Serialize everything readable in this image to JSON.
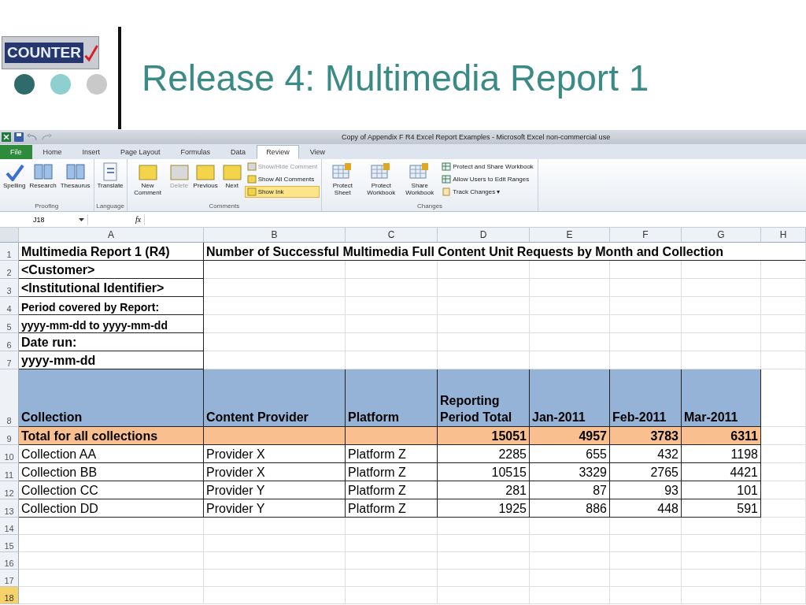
{
  "slide": {
    "logo_text": "COUNTER",
    "dots": [
      {
        "color": "#2f6b6a"
      },
      {
        "color": "#8ecfd0"
      },
      {
        "color": "#c9c9c9"
      }
    ],
    "title": "Release 4: Multimedia Report 1"
  },
  "excel": {
    "title": "Copy of Appendix F R4  Excel Report Examples  -  Microsoft Excel non-commercial use",
    "tabs": [
      {
        "label": "File",
        "kind": "file",
        "selected": false
      },
      {
        "label": "Home",
        "kind": "tab",
        "selected": false
      },
      {
        "label": "Insert",
        "kind": "tab",
        "selected": false
      },
      {
        "label": "Page Layout",
        "kind": "tab",
        "selected": false
      },
      {
        "label": "Formulas",
        "kind": "tab",
        "selected": false
      },
      {
        "label": "Data",
        "kind": "tab",
        "selected": false
      },
      {
        "label": "Review",
        "kind": "tab",
        "selected": true
      },
      {
        "label": "View",
        "kind": "tab",
        "selected": false
      }
    ],
    "groups": [
      {
        "label": "Proofing",
        "buttons": [
          {
            "label": "Spelling",
            "kind": "large",
            "disabled": false,
            "selected": false
          },
          {
            "label": "Research",
            "kind": "large",
            "disabled": false,
            "selected": false
          },
          {
            "label": "Thesaurus",
            "kind": "large",
            "disabled": false,
            "selected": false
          }
        ]
      },
      {
        "label": "Language",
        "buttons": [
          {
            "label": "Translate",
            "kind": "large",
            "disabled": false,
            "selected": false
          }
        ]
      },
      {
        "label": "Comments",
        "buttons": [
          {
            "label": "New Comment",
            "kind": "large",
            "disabled": false,
            "selected": false
          },
          {
            "label": "Delete",
            "kind": "large",
            "disabled": true,
            "selected": false
          },
          {
            "label": "Previous",
            "kind": "large",
            "disabled": false,
            "selected": false
          },
          {
            "label": "Next",
            "kind": "large",
            "disabled": false,
            "selected": false
          },
          {
            "label": "Show/Hide Comment",
            "kind": "small",
            "disabled": true,
            "selected": false
          },
          {
            "label": "Show All Comments",
            "kind": "small",
            "disabled": false,
            "selected": false
          },
          {
            "label": "Show Ink",
            "kind": "small",
            "disabled": false,
            "selected": true
          }
        ]
      },
      {
        "label": "Changes",
        "buttons": [
          {
            "label": "Protect Sheet",
            "kind": "large",
            "disabled": false,
            "selected": false
          },
          {
            "label": "Protect Workbook",
            "kind": "large",
            "disabled": false,
            "selected": false
          },
          {
            "label": "Share Workbook",
            "kind": "large",
            "disabled": false,
            "selected": false
          },
          {
            "label": "Protect and Share Workbook",
            "kind": "small",
            "disabled": false,
            "selected": false
          },
          {
            "label": "Allow Users to Edit Ranges",
            "kind": "small",
            "disabled": false,
            "selected": false
          },
          {
            "label": "Track Changes ▾",
            "kind": "small",
            "disabled": false,
            "selected": false
          }
        ]
      }
    ],
    "name_box": "J18",
    "function_label": "fx",
    "columns": [
      "A",
      "B",
      "C",
      "D",
      "E",
      "F",
      "G",
      "H"
    ],
    "rows": [
      {
        "number": "1",
        "kind": "title",
        "selected": false,
        "cells": [
          "Multimedia Report 1 (R4)",
          "Number of Successful Multimedia Full Content Unit Requests by Month and Collection"
        ]
      },
      {
        "number": "2",
        "kind": "info",
        "selected": false,
        "cells": [
          "<Customer>"
        ]
      },
      {
        "number": "3",
        "kind": "info",
        "selected": false,
        "cells": [
          "<Institutional Identifier>"
        ]
      },
      {
        "number": "4",
        "kind": "info-small",
        "selected": false,
        "cells": [
          "Period covered by Report:"
        ]
      },
      {
        "number": "5",
        "kind": "info-small",
        "selected": false,
        "cells": [
          "yyyy-mm-dd to yyyy-mm-dd"
        ]
      },
      {
        "number": "6",
        "kind": "info",
        "selected": false,
        "cells": [
          "Date run:"
        ]
      },
      {
        "number": "7",
        "kind": "info",
        "selected": false,
        "cells": [
          "yyyy-mm-dd"
        ]
      },
      {
        "number": "8",
        "kind": "header",
        "selected": false,
        "cells": [
          "Collection",
          "Content Provider",
          "Platform",
          "Reporting Period Total",
          "Jan-2011",
          "Feb-2011",
          "Mar-2011"
        ]
      },
      {
        "number": "9",
        "kind": "total",
        "selected": false,
        "cells": [
          "Total for all collections",
          "",
          "",
          "15051",
          "4957",
          "3783",
          "6311"
        ]
      },
      {
        "number": "10",
        "kind": "data",
        "selected": false,
        "cells": [
          "Collection AA",
          "Provider X",
          "Platform Z",
          "2285",
          "655",
          "432",
          "1198"
        ]
      },
      {
        "number": "11",
        "kind": "data",
        "selected": false,
        "cells": [
          "Collection BB",
          "Provider X",
          "Platform Z",
          "10515",
          "3329",
          "2765",
          "4421"
        ]
      },
      {
        "number": "12",
        "kind": "data",
        "selected": false,
        "cells": [
          "Collection CC",
          "Provider Y",
          "Platform Z",
          "281",
          "87",
          "93",
          "101"
        ]
      },
      {
        "number": "13",
        "kind": "data",
        "selected": false,
        "cells": [
          "Collection DD",
          "Provider Y",
          "Platform Z",
          "1925",
          "886",
          "448",
          "591"
        ]
      },
      {
        "number": "14",
        "kind": "empty",
        "selected": false,
        "cells": []
      },
      {
        "number": "15",
        "kind": "empty",
        "selected": false,
        "cells": []
      },
      {
        "number": "16",
        "kind": "empty",
        "selected": false,
        "cells": []
      },
      {
        "number": "17",
        "kind": "empty",
        "selected": false,
        "cells": []
      },
      {
        "number": "18",
        "kind": "empty",
        "selected": true,
        "cells": []
      }
    ]
  }
}
